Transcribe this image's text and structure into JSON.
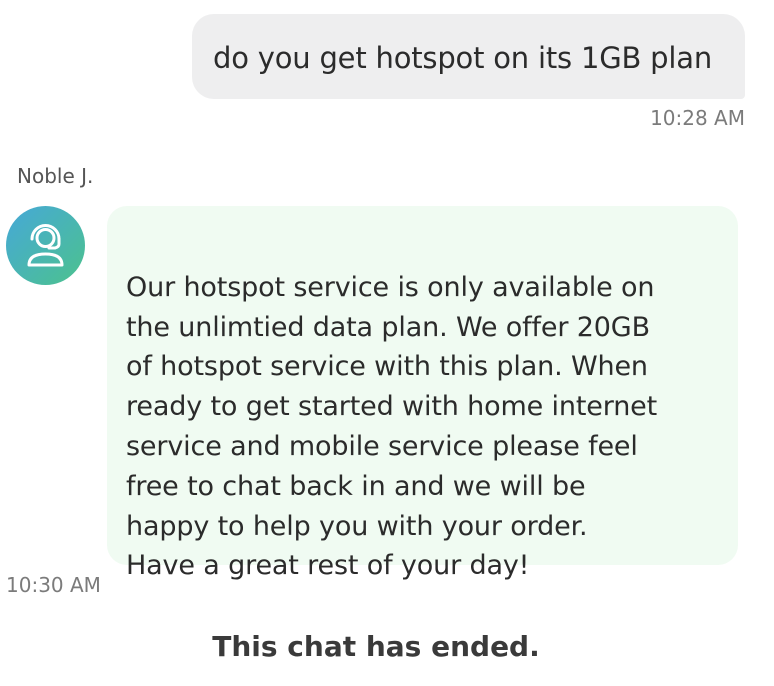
{
  "conversation": {
    "user_message": {
      "text": "do you get hotspot on its 1GB plan",
      "time": "10:28 AM"
    },
    "agent_message": {
      "sender": "Noble J.",
      "avatar_icon": "headset-agent-icon",
      "text": "Our hotspot service is only available on\nthe unlimtied data plan.  We offer 20GB\nof hotspot service with this plan. When\nready to get started with home internet\nservice and mobile service please feel\nfree to chat back in and we will be\nhappy to help you with your order.\nHave a great rest of your day!",
      "time": "10:30 AM"
    },
    "status": "This chat has ended."
  },
  "colors": {
    "user_bubble": "#eeeeef",
    "agent_bubble": "#f0fbf2",
    "avatar_gradient_start": "#46a8d8",
    "avatar_gradient_end": "#4cc28d"
  }
}
